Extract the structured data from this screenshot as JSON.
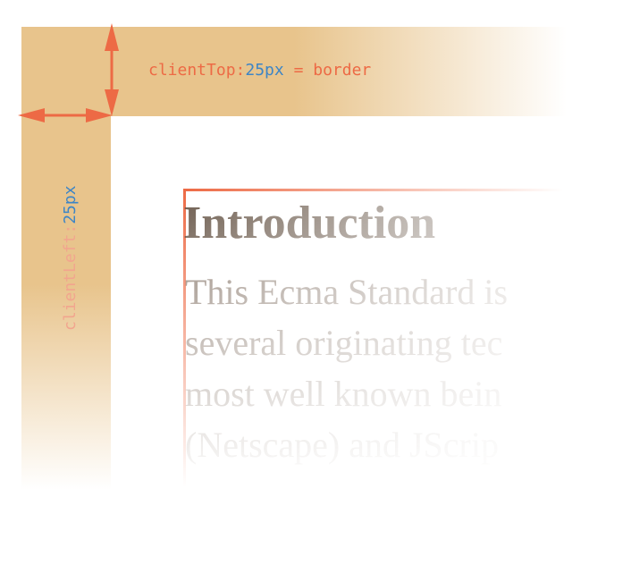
{
  "labels": {
    "client_top_prefix": "clientTop:",
    "client_top_value": "25px",
    "client_top_suffix": " = border",
    "client_left_prefix": "clientLeft:",
    "client_left_value": "25px"
  },
  "content": {
    "heading": "Introduction",
    "lines": [
      "This Ecma Standard is",
      "several originating tec",
      "most well known bein",
      "(Netscape) and JScrip"
    ]
  },
  "colors": {
    "border": "#e8c48c",
    "accent": "#ed6a45",
    "value": "#3d85c6",
    "text": "#6b5a4c"
  }
}
